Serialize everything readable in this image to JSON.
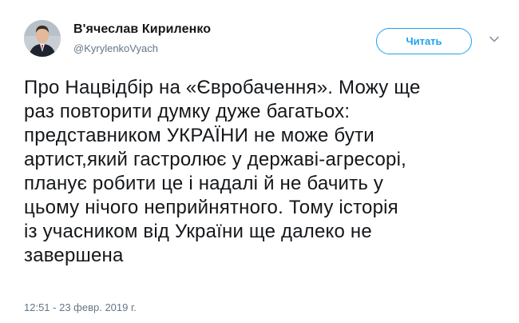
{
  "author": {
    "name": "В'ячеслав Кириленко",
    "handle": "@KyrylenkoVyach"
  },
  "follow_button": {
    "label": "Читать",
    "color": "#1da1f2"
  },
  "menu_icon": "chevron-down-icon",
  "tweet": {
    "lines": [
      "Про Нацвідбір на «Євробачення». Можу ще",
      "раз повторити думку дуже багатьох:",
      "представником УКРАЇНИ не може бути",
      "артист,який гастролює у державі-агресорі,",
      "планує робити це і надалі й не бачить у",
      "цьому нічого неприйнятного. Тому історія",
      "із учасником від України ще далеко не",
      "завершена"
    ],
    "timestamp": "12:51 - 23 февр. 2019 г."
  },
  "colors": {
    "text": "#14171a",
    "secondary": "#657786",
    "accent": "#1da1f2"
  }
}
